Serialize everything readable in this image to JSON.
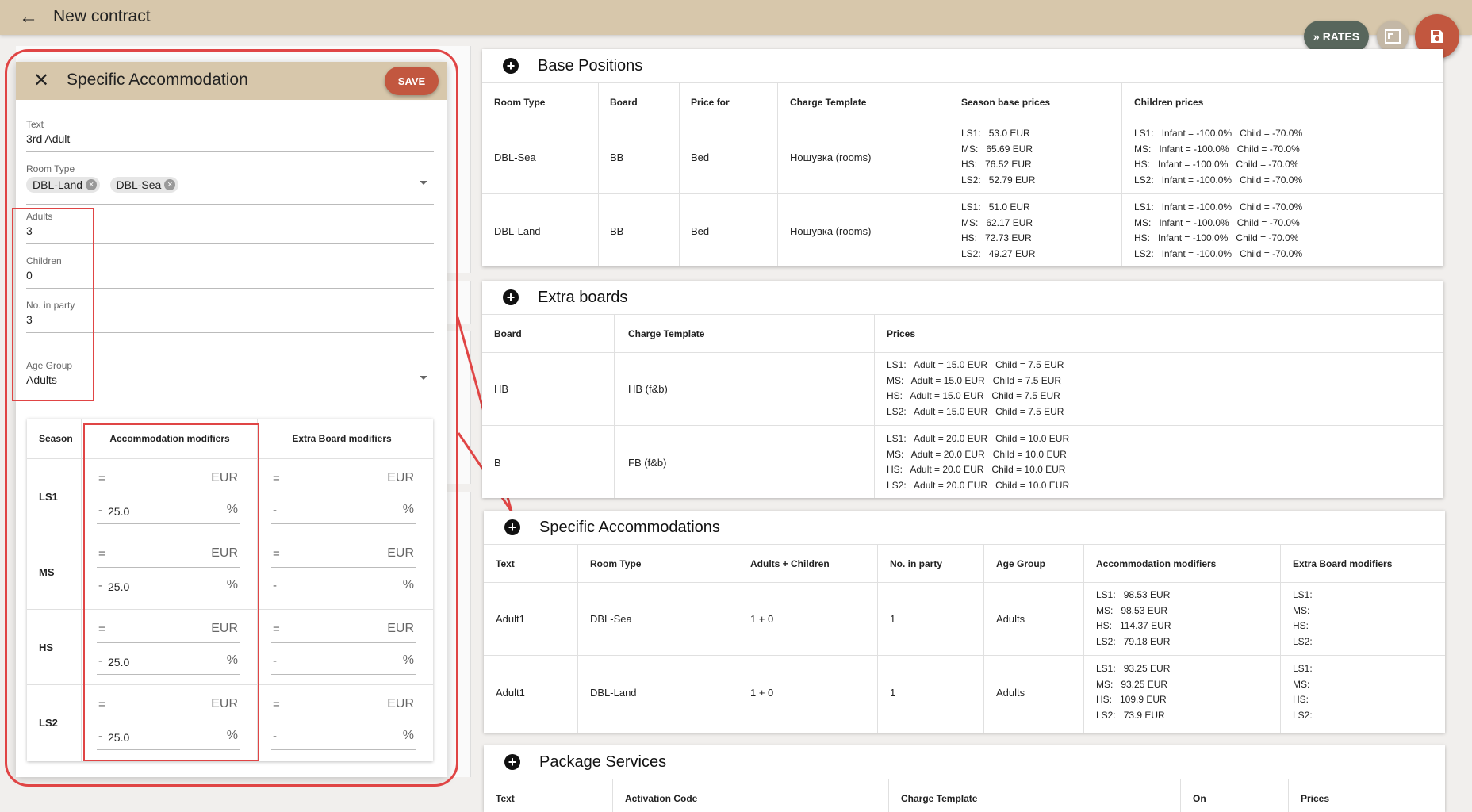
{
  "app": {
    "title": "New contract",
    "rates_label": "RATES"
  },
  "dialog": {
    "title": "Specific Accommodation",
    "save_label": "SAVE",
    "fields": {
      "text": {
        "label": "Text",
        "value": "3rd Adult"
      },
      "room_type": {
        "label": "Room Type",
        "chips": [
          "DBL-Land",
          "DBL-Sea"
        ]
      },
      "adults": {
        "label": "Adults",
        "value": "3"
      },
      "children": {
        "label": "Children",
        "value": "0"
      },
      "no_in_party": {
        "label": "No. in party",
        "value": "3"
      },
      "age_group": {
        "label": "Age Group",
        "value": "Adults"
      }
    },
    "modifiers": {
      "headers": {
        "season": "Season",
        "accommodation": "Accommodation modifiers",
        "extra_board": "Extra Board modifiers"
      },
      "rows": [
        {
          "season": "LS1",
          "acc_op1": "=",
          "acc_unit1": "EUR",
          "acc_op2": "-",
          "acc_val2": "25.0",
          "acc_unit2": "%",
          "eb_op1": "=",
          "eb_unit1": "EUR",
          "eb_op2": "-",
          "eb_unit2": "%"
        },
        {
          "season": "MS",
          "acc_op1": "=",
          "acc_unit1": "EUR",
          "acc_op2": "-",
          "acc_val2": "25.0",
          "acc_unit2": "%",
          "eb_op1": "=",
          "eb_unit1": "EUR",
          "eb_op2": "-",
          "eb_unit2": "%"
        },
        {
          "season": "HS",
          "acc_op1": "=",
          "acc_unit1": "EUR",
          "acc_op2": "-",
          "acc_val2": "25.0",
          "acc_unit2": "%",
          "eb_op1": "=",
          "eb_unit1": "EUR",
          "eb_op2": "-",
          "eb_unit2": "%"
        },
        {
          "season": "LS2",
          "acc_op1": "=",
          "acc_unit1": "EUR",
          "acc_op2": "-",
          "acc_val2": "25.0",
          "acc_unit2": "%",
          "eb_op1": "=",
          "eb_unit1": "EUR",
          "eb_op2": "-",
          "eb_unit2": "%"
        }
      ]
    }
  },
  "base_positions": {
    "title": "Base Positions",
    "headers": [
      "Room Type",
      "Board",
      "Price for",
      "Charge Template",
      "Season base prices",
      "Children prices"
    ],
    "rows": [
      {
        "room_type": "DBL-Sea",
        "board": "BB",
        "price_for": "Bed",
        "charge_template": "Нощувка (rooms)",
        "season_prices": "LS1:   53.0 EUR\nMS:   65.69 EUR\nHS:   76.52 EUR\nLS2:   52.79 EUR",
        "children_prices": "LS1:   Infant = -100.0%   Child = -70.0%\nMS:   Infant = -100.0%   Child = -70.0%\nHS:   Infant = -100.0%   Child = -70.0%\nLS2:   Infant = -100.0%   Child = -70.0%"
      },
      {
        "room_type": "DBL-Land",
        "board": "BB",
        "price_for": "Bed",
        "charge_template": "Нощувка (rooms)",
        "season_prices": "LS1:   51.0 EUR\nMS:   62.17 EUR\nHS:   72.73 EUR\nLS2:   49.27 EUR",
        "children_prices": "LS1:   Infant = -100.0%   Child = -70.0%\nMS:   Infant = -100.0%   Child = -70.0%\nHS:   Infant = -100.0%   Child = -70.0%\nLS2:   Infant = -100.0%   Child = -70.0%"
      }
    ]
  },
  "extra_boards": {
    "title": "Extra boards",
    "headers": [
      "Board",
      "Charge Template",
      "Prices"
    ],
    "rows": [
      {
        "board": "HB",
        "charge_template": "HB (f&b)",
        "prices": "LS1:   Adult = 15.0 EUR   Child = 7.5 EUR\nMS:   Adult = 15.0 EUR   Child = 7.5 EUR\nHS:   Adult = 15.0 EUR   Child = 7.5 EUR\nLS2:   Adult = 15.0 EUR   Child = 7.5 EUR"
      },
      {
        "board": "B",
        "charge_template": "FB (f&b)",
        "prices": "LS1:   Adult = 20.0 EUR   Child = 10.0 EUR\nMS:   Adult = 20.0 EUR   Child = 10.0 EUR\nHS:   Adult = 20.0 EUR   Child = 10.0 EUR\nLS2:   Adult = 20.0 EUR   Child = 10.0 EUR"
      }
    ]
  },
  "specific_accommodations": {
    "title": "Specific Accommodations",
    "headers": [
      "Text",
      "Room Type",
      "Adults + Children",
      "No. in party",
      "Age Group",
      "Accommodation modifiers",
      "Extra Board modifiers"
    ],
    "rows": [
      {
        "text": "Adult1",
        "room_type": "DBL-Sea",
        "adults_children": "1 + 0",
        "no_in_party": "1",
        "age_group": "Adults",
        "acc_mods": "LS1:   98.53 EUR\nMS:   98.53 EUR\nHS:   114.37 EUR\nLS2:   79.18 EUR",
        "eb_mods": "LS1:\nMS:\nHS:\nLS2:"
      },
      {
        "text": "Adult1",
        "room_type": "DBL-Land",
        "adults_children": "1 + 0",
        "no_in_party": "1",
        "age_group": "Adults",
        "acc_mods": "LS1:   93.25 EUR\nMS:   93.25 EUR\nHS:   109.9 EUR\nLS2:   73.9 EUR",
        "eb_mods": "LS1:\nMS:\nHS:\nLS2:"
      }
    ]
  },
  "package_services": {
    "title": "Package Services",
    "headers": [
      "Text",
      "Activation Code",
      "Charge Template",
      "On",
      "Prices"
    ]
  },
  "colors": {
    "header_bg": "#d7c7ab",
    "accent_red": "#c2573f",
    "rates_green": "#58665c",
    "highlight": "#e04545"
  },
  "icons": [
    "back-arrow-icon",
    "close-icon",
    "plus-circle-icon",
    "double-chevron-right-icon",
    "fullscreen-icon",
    "floppy-disk-icon",
    "chip-remove-icon",
    "dropdown-arrow-icon"
  ]
}
